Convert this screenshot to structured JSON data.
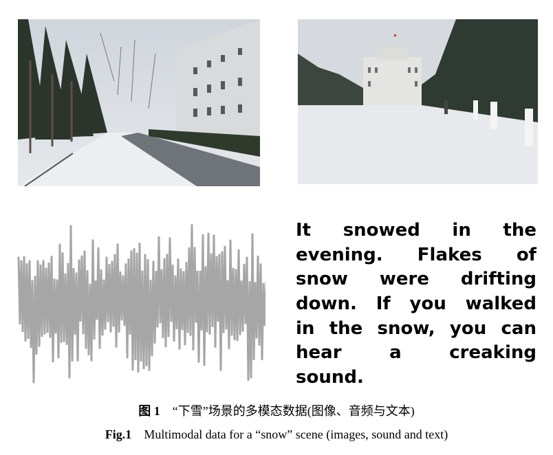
{
  "figure": {
    "text_panel": {
      "lines": [
        "It snowed in the",
        "evening. Flakes of",
        "snow were drifting",
        "down. If you walked",
        "in the snow, you can",
        "hear a creaking",
        "sound."
      ]
    },
    "caption_cn": {
      "label": "图 1",
      "text": "“下雪”场景的多模态数据(图像、音频与文本)"
    },
    "caption_en": {
      "label": "Fig.1",
      "text": "Multimodal data for a “snow” scene (images, sound and text)"
    },
    "colors": {
      "waveform": "#a6a6a6",
      "snow": "#e9ebef",
      "sky": "#d9dde2"
    }
  }
}
